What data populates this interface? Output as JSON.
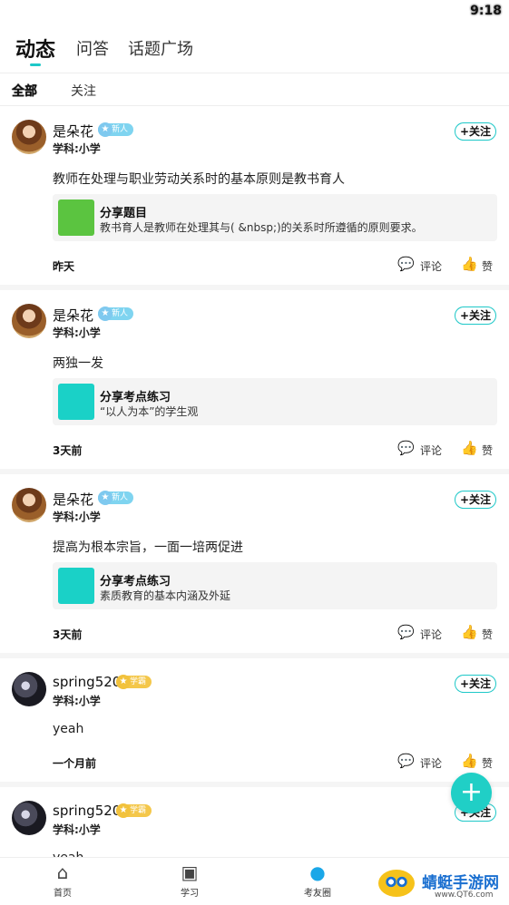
{
  "status_bar": {
    "time": "9:18"
  },
  "top_tabs": [
    "动态",
    "问答",
    "话题广场"
  ],
  "sub_tabs": [
    "全部",
    "关注"
  ],
  "follow_label": "+关注",
  "comment_label": "评论",
  "like_label": "赞",
  "posts": [
    {
      "user": "是朵花",
      "badge": "新人",
      "subject": "学科:小学",
      "content": "教师在处理与职业劳动关系时的基本原则是教书育人",
      "share_title": "分享题目",
      "share_sub": "教书育人是教师在处理其与( &nbsp;)的关系时所遵循的原则要求。",
      "time": "昨天"
    },
    {
      "user": "是朵花",
      "badge": "新人",
      "subject": "学科:小学",
      "content": "两独一发",
      "share_title": "分享考点练习",
      "share_sub": "“以人为本”的学生观",
      "time": "3天前"
    },
    {
      "user": "是朵花",
      "badge": "新人",
      "subject": "学科:小学",
      "content": "提高为根本宗旨，一面一培两促进",
      "share_title": "分享考点练习",
      "share_sub": "素质教育的基本内涵及外延",
      "time": "3天前"
    },
    {
      "user": "spring520",
      "badge": "学霸",
      "subject": "学科:小学",
      "content": "yeah",
      "time": "一个月前"
    },
    {
      "user": "spring520",
      "badge": "学霸",
      "subject": "学科:小学",
      "content": "yeah"
    }
  ],
  "bottom_nav": [
    "首页",
    "学习",
    "考友圈"
  ],
  "watermark": {
    "title": "蜻蜓手游网",
    "url": "www.QT6.com"
  },
  "colors": {
    "accent": "#1ec8c8",
    "fab": "#20cfc6",
    "badge_new": "#7fd4f0",
    "badge_scholar": "#f4c74a"
  }
}
